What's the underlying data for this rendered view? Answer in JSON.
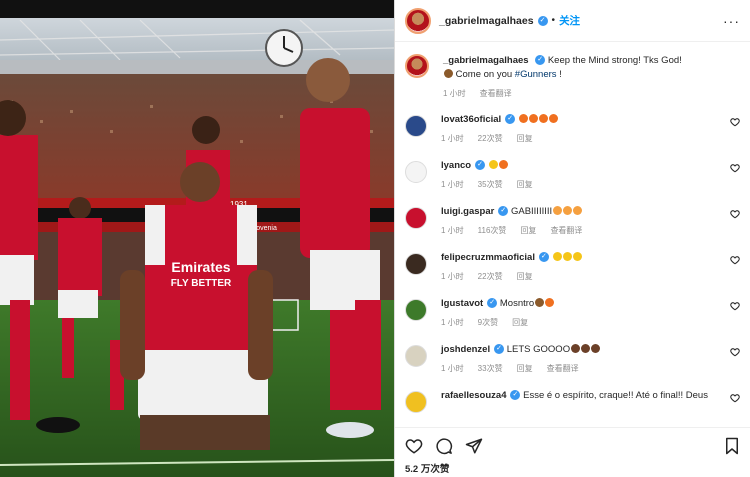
{
  "header": {
    "username": "_gabrielmagalhaes",
    "separator": "•",
    "follow_label": "关注",
    "more": "···"
  },
  "caption": {
    "username": "_gabrielmagalhaes",
    "text_part1": "Keep the Mind strong! Tks God!",
    "text_part2": "Come on you",
    "hashtag": "#Gunners",
    "text_part3": "!",
    "time": "1 小时",
    "translate": "查看翻译"
  },
  "comments": [
    {
      "username": "lovat36oficial",
      "text": "",
      "emojis": [
        "fire",
        "fire",
        "fire",
        "fire"
      ],
      "time": "1 小时",
      "likes": "22次赞",
      "reply": "回复",
      "translate": ""
    },
    {
      "username": "lyanco",
      "text": "",
      "emojis": [
        "clap",
        "fire"
      ],
      "time": "1 小时",
      "likes": "35次赞",
      "reply": "回复",
      "translate": ""
    },
    {
      "username": "luigi.gaspar",
      "text": "GABIIIIIIII",
      "emojis": [
        "stars",
        "stars",
        "stars"
      ],
      "time": "1 小时",
      "likes": "116次赞",
      "reply": "回复",
      "translate": "查看翻译"
    },
    {
      "username": "felipecruzmmaoficial",
      "text": "",
      "emojis": [
        "clap",
        "clap",
        "clap"
      ],
      "time": "1 小时",
      "likes": "22次赞",
      "reply": "回复",
      "translate": ""
    },
    {
      "username": "lgustavot",
      "text": "Mosntro",
      "emojis": [
        "muscle",
        "fire"
      ],
      "time": "1 小时",
      "likes": "9次赞",
      "reply": "回复",
      "translate": ""
    },
    {
      "username": "joshdenzel",
      "text": "LETS GOOOO",
      "emojis": [
        "fist",
        "fist",
        "fist"
      ],
      "time": "1 小时",
      "likes": "33次赞",
      "reply": "回复",
      "translate": "查看翻译"
    },
    {
      "username": "rafaellesouza4",
      "text": "Esse é o espírito, craque!! Até o final!! Deus",
      "emojis": [],
      "time": "",
      "likes": "",
      "reply": "",
      "translate": ""
    }
  ],
  "likes_total": "5.2 万次赞",
  "colors": {
    "accent": "#0095f6",
    "verified": "#3897f0",
    "arsenal_red": "#c8102e"
  },
  "photo": {
    "stadium_text_1": "Emirates",
    "stadium_text_2": "FLY BETTER",
    "board_text": "Slovenia",
    "year_text": "1931"
  }
}
